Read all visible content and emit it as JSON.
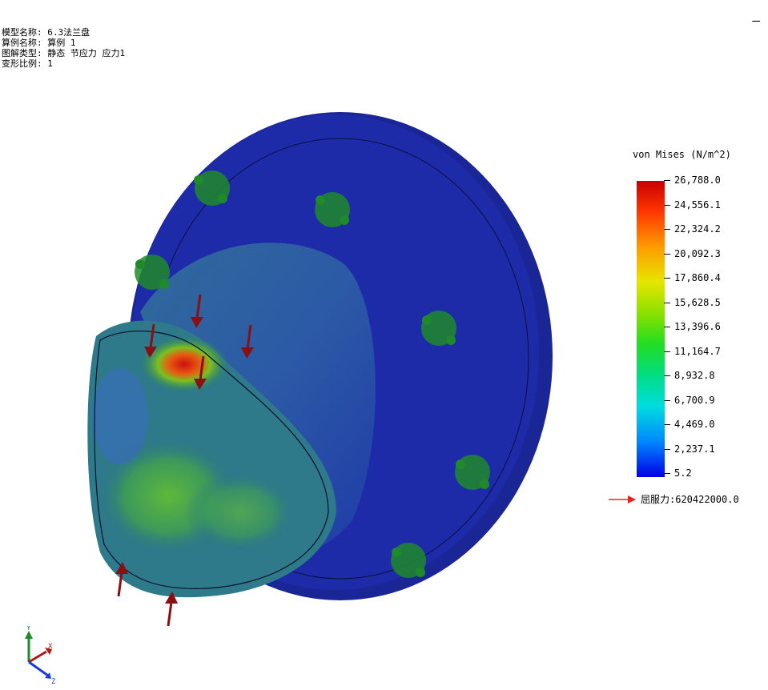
{
  "info": {
    "model_name": "模型名称: 6.3法兰盘",
    "study_name": "算例名称: 算例 1",
    "plot_type": "图解类型: 静态 节应力 应力1",
    "deformation_scale": "变形比例: 1"
  },
  "window": {
    "minimize_label": "—"
  },
  "legend": {
    "title": "von Mises (N/m^2)",
    "ticks": [
      "26,788.0",
      "24,556.1",
      "22,324.2",
      "20,092.3",
      "17,860.4",
      "15,628.5",
      "13,396.6",
      "11,164.7",
      "8,932.8",
      "6,700.9",
      "4,469.0",
      "2,237.1",
      "5.2"
    ],
    "max": 26788.0,
    "min": 5.2,
    "yield_label": "屈服力:620422000.0",
    "yield_arrow_color": "#e8231d"
  },
  "triad": {
    "x": "X",
    "y": "Y",
    "z": "Z"
  },
  "colors": {
    "flange": "#1a2a9e",
    "load_arrow": "#8b0f12",
    "fixture": "#1f8a2a"
  }
}
